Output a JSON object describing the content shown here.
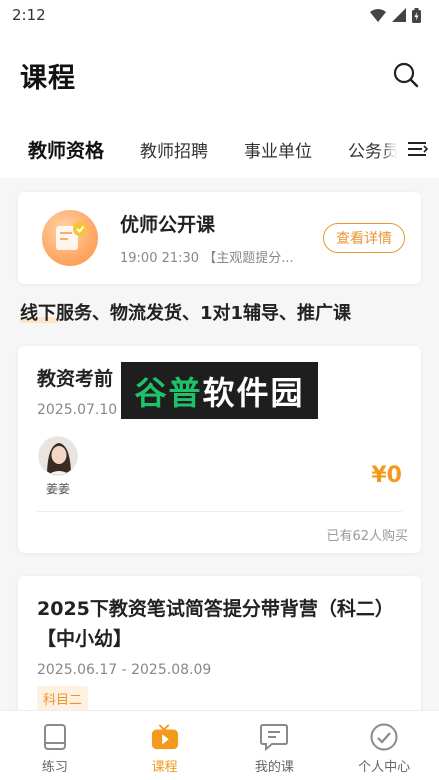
{
  "status_bar": {
    "time": "2:12"
  },
  "header": {
    "title": "课程"
  },
  "tabs": [
    {
      "label": "教师资格",
      "active": true
    },
    {
      "label": "教师招聘",
      "active": false
    },
    {
      "label": "事业单位",
      "active": false
    },
    {
      "label": "公务员",
      "active": false
    }
  ],
  "open_course": {
    "title": "优师公开课",
    "subtitle": "19:00 21:30 【主观题提分...",
    "detail_label": "查看详情"
  },
  "section_heading": "线下服务、物流发货、1对1辅导、推广课",
  "courses": [
    {
      "title": "教资考前",
      "date": "2025.07.10 - 2025.07.10",
      "teacher_name": "姜姜",
      "price": "¥0",
      "buyers": "已有62人购买"
    },
    {
      "title": "2025下教资笔试简答提分带背营（科二）【中小幼】",
      "date": "2025.06.17 - 2025.08.09",
      "tag": "科目二"
    }
  ],
  "watermark": {
    "green": "谷普",
    "white": "软件园"
  },
  "bottom_nav": [
    {
      "label": "练习",
      "icon": "book-icon",
      "active": false
    },
    {
      "label": "课程",
      "icon": "video-icon",
      "active": true
    },
    {
      "label": "我的课",
      "icon": "chat-icon",
      "active": false
    },
    {
      "label": "个人中心",
      "icon": "profile-icon",
      "active": false
    }
  ],
  "colors": {
    "accent": "#f39a1c",
    "background": "#f6f6f6"
  }
}
